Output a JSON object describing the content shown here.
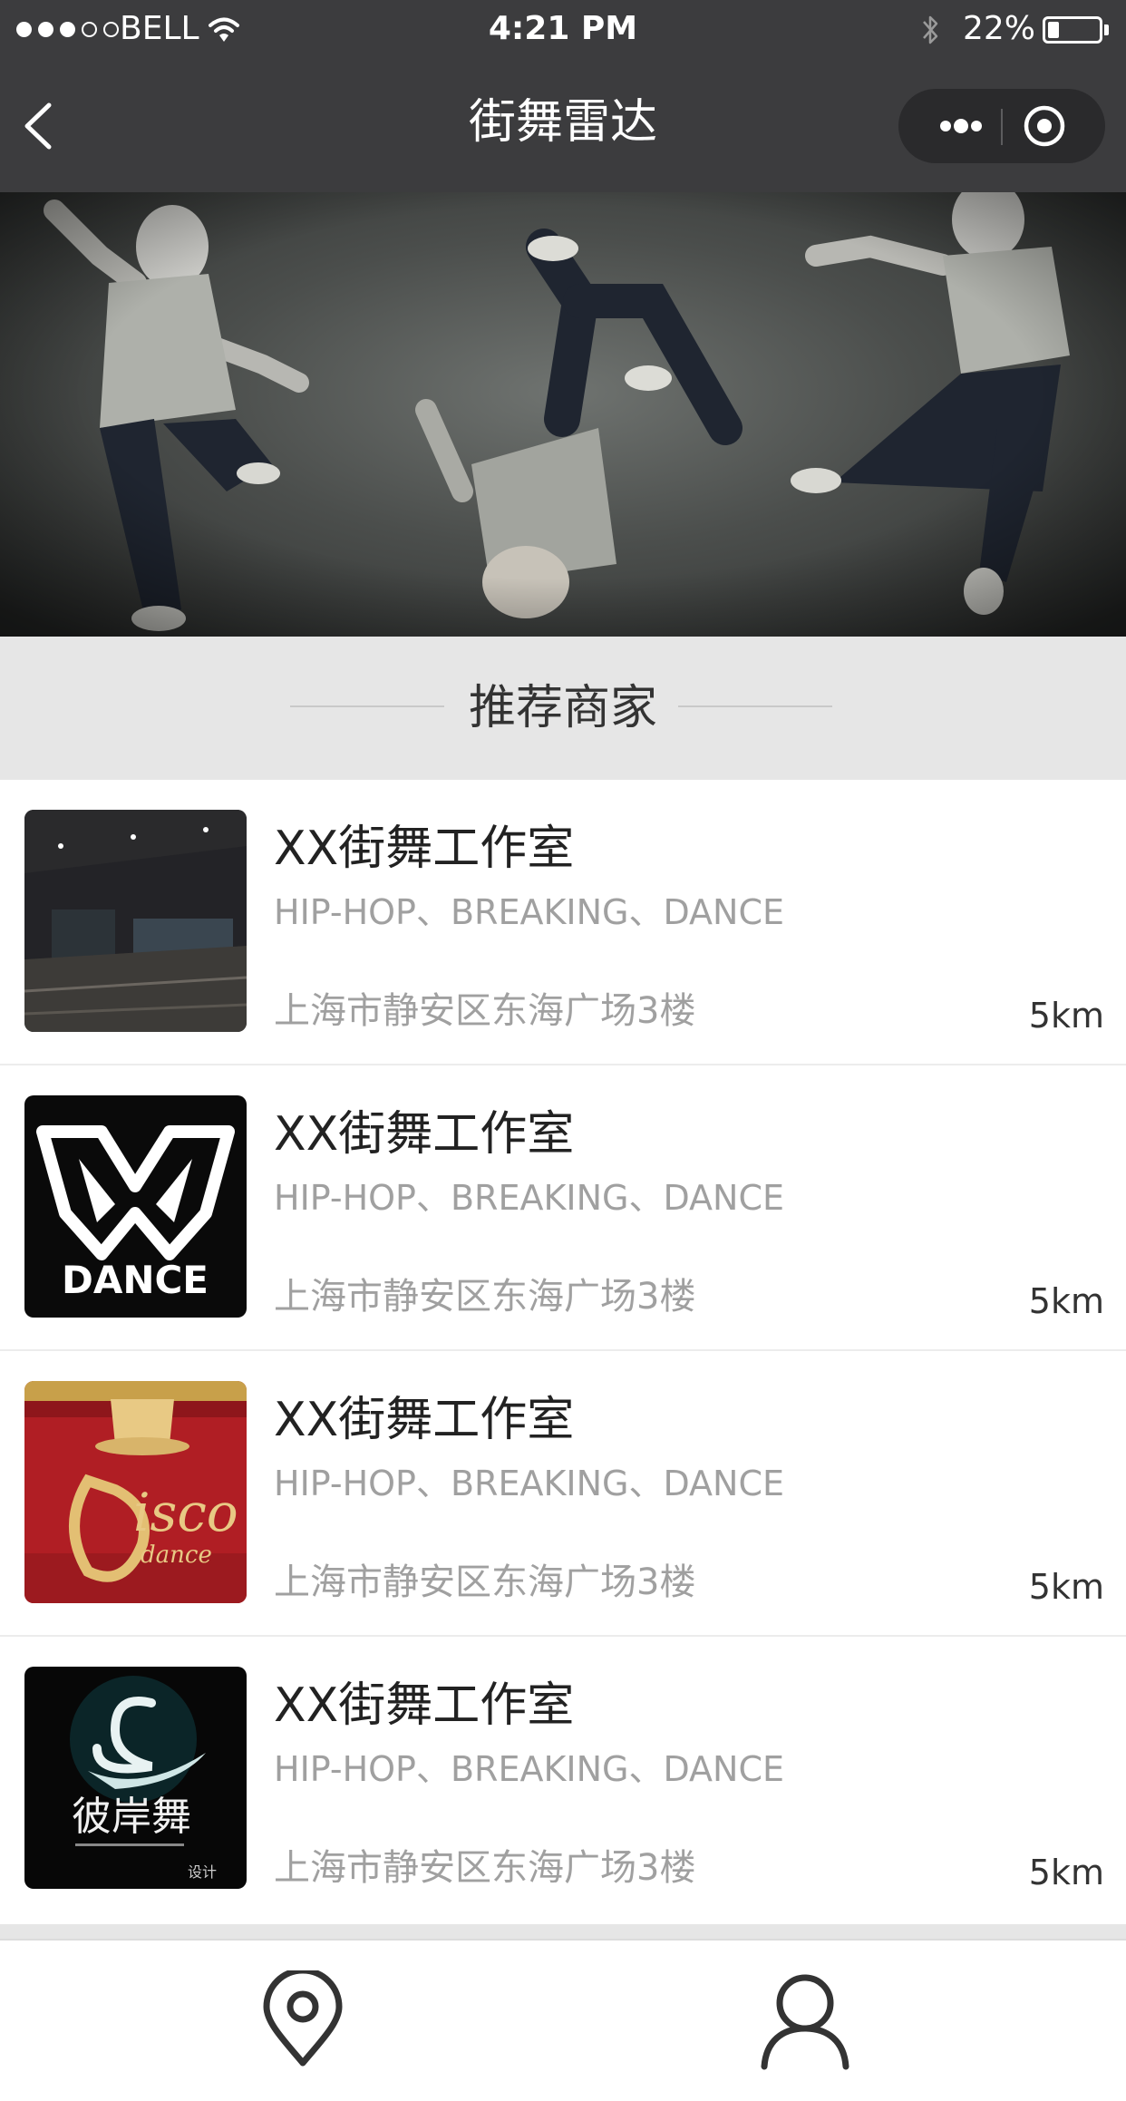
{
  "status_bar": {
    "carrier": "BELL",
    "time": "4:21 PM",
    "battery": "22%",
    "battery_level": 0.22
  },
  "nav": {
    "title": "街舞雷达",
    "back_icon": "chevron-left-icon",
    "more_icon": "more-dots-icon",
    "close_icon": "target-circle-icon"
  },
  "banner": {
    "subject": "three hip-hop dancers jumping"
  },
  "section": {
    "title": "推荐商家"
  },
  "merchants": [
    {
      "name": "XX街舞工作室",
      "tags": "HIP-HOP、BREAKING、DANCE",
      "address": "上海市静安区东海广场3楼",
      "distance": "5km",
      "thumb": "dance-studio-photo"
    },
    {
      "name": "XX街舞工作室",
      "tags": "HIP-HOP、BREAKING、DANCE",
      "address": "上海市静安区东海广场3楼",
      "distance": "5km",
      "thumb": "dance-logo-black"
    },
    {
      "name": "XX街舞工作室",
      "tags": "HIP-HOP、BREAKING、DANCE",
      "address": "上海市静安区东海广场3楼",
      "distance": "5km",
      "thumb": "disco-logo-red"
    },
    {
      "name": "XX街舞工作室",
      "tags": "HIP-HOP、BREAKING、DANCE",
      "address": "上海市静安区东海广场3楼",
      "distance": "5km",
      "thumb": "swan-logo-dark"
    }
  ],
  "tabbar": {
    "tabs": [
      {
        "icon": "location-pin-icon"
      },
      {
        "icon": "person-icon"
      }
    ]
  },
  "colors": {
    "topbar": "#3c3c3e",
    "section_bg": "#e6e6e6",
    "secondary_text": "#a0a0a0"
  }
}
